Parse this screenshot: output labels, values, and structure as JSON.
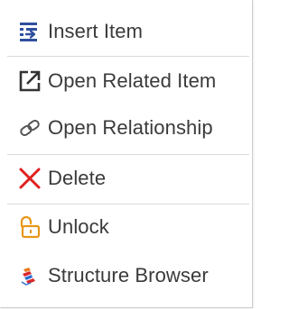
{
  "menu": {
    "items": [
      {
        "label": "Insert Item",
        "icon": "insert-item-icon"
      },
      {
        "label": "Open Related Item",
        "icon": "open-external-icon"
      },
      {
        "label": "Open Relationship",
        "icon": "relationship-link-icon"
      },
      {
        "label": "Delete",
        "icon": "delete-x-icon"
      },
      {
        "label": "Unlock",
        "icon": "unlock-padlock-icon"
      },
      {
        "label": "Structure Browser",
        "icon": "structure-browser-icon"
      }
    ]
  },
  "colors": {
    "text": "#3a3a3a",
    "insert_icon": "#2f4f9f",
    "open_icon": "#333333",
    "relationship_icon": "#555555",
    "delete_icon": "#e01f1f",
    "unlock_icon": "#e8961a",
    "structure_icon_orange": "#e87d1e",
    "structure_icon_red": "#d9262b",
    "structure_icon_blue": "#2e6fd1"
  }
}
